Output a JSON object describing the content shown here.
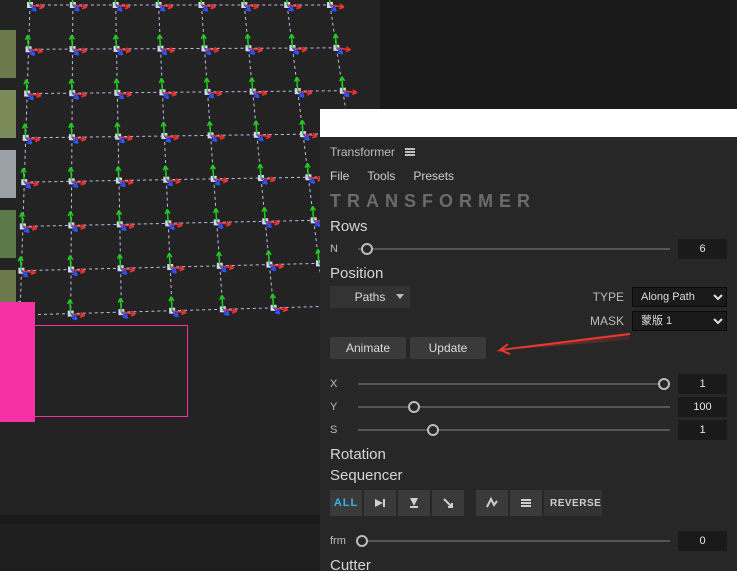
{
  "panel": {
    "title": "Transformer"
  },
  "menu": {
    "file": "File",
    "tools": "Tools",
    "presets": "Presets"
  },
  "logo": "TRANSFORMER",
  "rows": {
    "heading": "Rows",
    "n_label": "N",
    "n_value": "6",
    "n_pct": 3
  },
  "position": {
    "heading": "Position",
    "paths_label": "Paths",
    "type_label": "TYPE",
    "type_value": "Along Path",
    "mask_label": "MASK",
    "mask_value": "蒙版 1",
    "animate_label": "Animate",
    "update_label": "Update",
    "x_label": "X",
    "x_value": "1",
    "x_pct": 98,
    "y_label": "Y",
    "y_value": "100",
    "y_pct": 18,
    "s_label": "S",
    "s_value": "1",
    "s_pct": 24
  },
  "rotation": {
    "heading": "Rotation"
  },
  "sequencer": {
    "heading": "Sequencer",
    "all_label": "ALL",
    "reverse_label": "REVERSE",
    "frm_label": "frm",
    "frm_value": "0",
    "frm_pct": 0
  },
  "cutter": {
    "heading": "Cutter"
  }
}
